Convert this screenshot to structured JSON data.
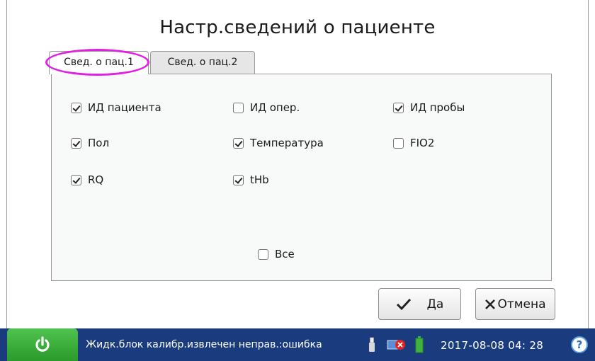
{
  "dialog": {
    "title": "Настр.сведений о пациенте",
    "tabs": [
      {
        "label": "Свед. о пац.1",
        "active": true
      },
      {
        "label": "Свед. о пац.2",
        "active": false
      }
    ],
    "options": [
      {
        "label": "ИД пациента",
        "checked": true
      },
      {
        "label": "ИД опер.",
        "checked": false
      },
      {
        "label": "ИД пробы",
        "checked": true
      },
      {
        "label": "Пол",
        "checked": true
      },
      {
        "label": "Температура",
        "checked": true
      },
      {
        "label": "FIO2",
        "checked": false
      },
      {
        "label": "RQ",
        "checked": true
      },
      {
        "label": "tHb",
        "checked": true
      }
    ],
    "select_all": {
      "label": "Все",
      "checked": false
    },
    "ok_label": "Да",
    "cancel_label": "Отмена",
    "ok_icon": "checkmark-icon",
    "cancel_icon": "x-icon"
  },
  "statusbar": {
    "message": "Жидк.блок калибр.извлечен неправ.:ошибка",
    "datetime": "2017-08-08 04: 28",
    "help_label": "?",
    "icons": [
      "power-icon",
      "usb-icon",
      "network-error-icon",
      "battery-icon",
      "help-icon"
    ]
  },
  "colors": {
    "statusbar_bg": "#1a3c7e",
    "power_button": "#3fb33f",
    "highlight_ring": "#e21ee2",
    "panel_bg": "#f7faf9"
  }
}
